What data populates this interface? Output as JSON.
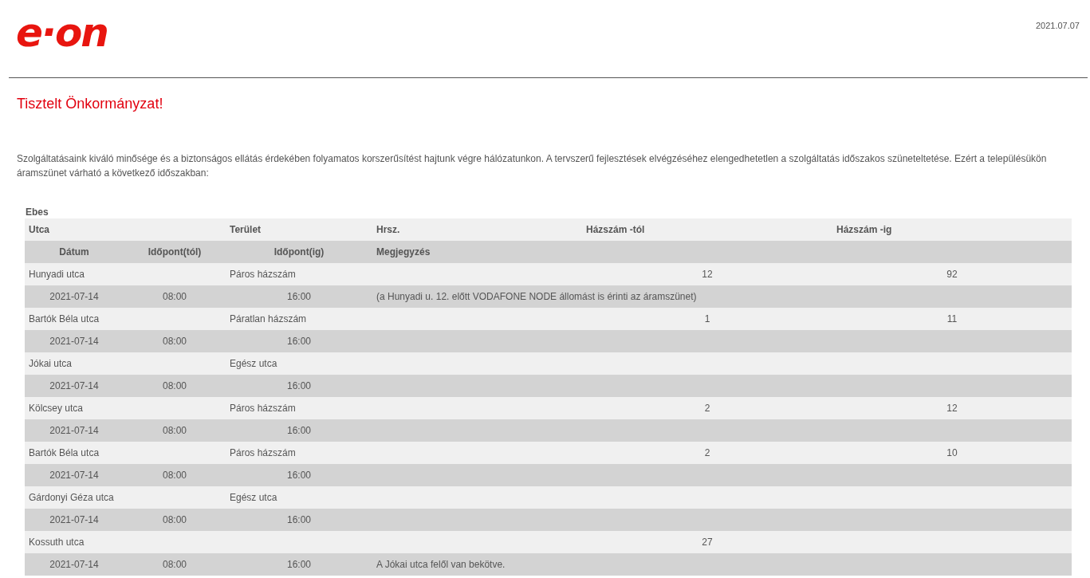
{
  "header": {
    "logo": "e·on",
    "date": "2021.07.07"
  },
  "greeting": "Tisztelt Önkormányzat!",
  "intro": "Szolgáltatásaink kiváló minősége és a biztonságos ellátás érdekében folyamatos korszerűsítést hajtunk végre hálózatunkon. A tervszerű fejlesztések elvégzéséhez elengedhetetlen a szolgáltatás időszakos szüneteltetése. Ezért a településükön áramszünet várható a következő időszakban:",
  "table": {
    "settlement": "Ebes",
    "columns": [
      "Utca",
      "Terület",
      "Hrsz.",
      "Házszám -tól",
      "Házszám -ig"
    ],
    "sub_columns": [
      "Dátum",
      "Időpont(tól)",
      "Időpont(ig)",
      "Megjegyzés"
    ],
    "rows": [
      {
        "street": "Hunyadi utca",
        "area": "Páros házszám",
        "from": "12",
        "to": "92",
        "date": "2021-07-14",
        "time_from": "08:00",
        "time_to": "16:00",
        "note": "(a Hunyadi u. 12. előtt VODAFONE NODE állomást is érinti az áramszünet)"
      },
      {
        "street": "Bartók Béla utca",
        "area": "Páratlan házszám",
        "from": "1",
        "to": "11",
        "date": "2021-07-14",
        "time_from": "08:00",
        "time_to": "16:00"
      },
      {
        "street": "Jókai utca",
        "area": "Egész utca",
        "date": "2021-07-14",
        "time_from": "08:00",
        "time_to": "16:00"
      },
      {
        "street": "Kölcsey utca",
        "area": "Páros házszám",
        "from": "2",
        "to": "12",
        "date": "2021-07-14",
        "time_from": "08:00",
        "time_to": "16:00"
      },
      {
        "street": "Bartók Béla utca",
        "area": "Páros házszám",
        "from": "2",
        "to": "10",
        "date": "2021-07-14",
        "time_from": "08:00",
        "time_to": "16:00"
      },
      {
        "street": "Gárdonyi Géza utca",
        "area": "Egész utca",
        "date": "2021-07-14",
        "time_from": "08:00",
        "time_to": "16:00"
      },
      {
        "street": "Kossuth utca",
        "from": "27",
        "date": "2021-07-14",
        "time_from": "08:00",
        "time_to": "16:00",
        "note": "A Jókai utca felől van bekötve."
      }
    ]
  }
}
